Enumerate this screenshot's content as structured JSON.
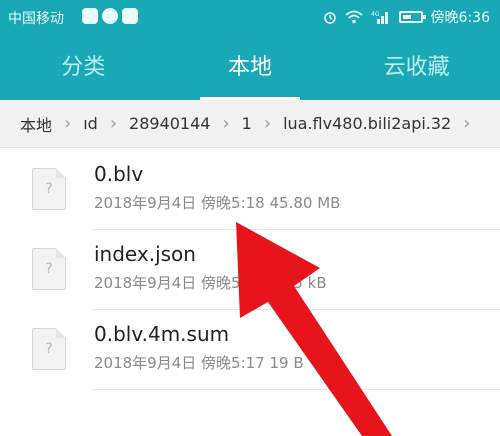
{
  "status_bar": {
    "carrier": "中国移动",
    "time": "傍晚6:36",
    "signal_label": "4G"
  },
  "tabs": [
    {
      "label": "分类",
      "active": false
    },
    {
      "label": "本地",
      "active": true
    },
    {
      "label": "云收藏",
      "active": false
    }
  ],
  "breadcrumb": [
    "本地",
    "ıd",
    "28940144",
    "1",
    "lua.flv480.bili2api.32"
  ],
  "files": [
    {
      "name": "0.blv",
      "meta": "2018年9月4日 傍晚5:18 45.80 MB",
      "icon": "unknown-file-icon"
    },
    {
      "name": "index.json",
      "meta": "2018年9月4日 傍晚5:18 1.85 kB",
      "icon": "unknown-file-icon"
    },
    {
      "name": "0.blv.4m.sum",
      "meta": "2018年9月4日 傍晚5:17 19 B",
      "icon": "unknown-file-icon"
    }
  ],
  "colors": {
    "header": "#18a8b6",
    "annotation_arrow": "#e8141c"
  }
}
